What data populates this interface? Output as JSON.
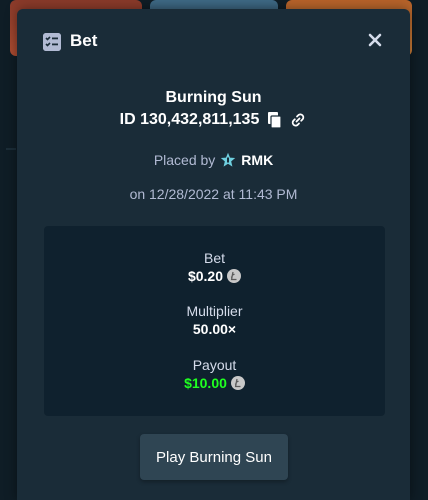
{
  "modal": {
    "title": "Bet",
    "game_name": "Burning Sun",
    "bet_id": "ID 130,432,811,135",
    "placed_by_prefix": "Placed by",
    "user": "RMK",
    "date_text": "on 12/28/2022 at 11:43 PM",
    "play_button_label": "Play Burning Sun"
  },
  "stats": {
    "bet_label": "Bet",
    "bet_value": "$0.20",
    "multiplier_label": "Multiplier",
    "multiplier_value": "50.00×",
    "payout_label": "Payout",
    "payout_value": "$10.00"
  },
  "icons": {
    "header": "bets-list-icon",
    "close": "close-icon",
    "copy": "copy-icon",
    "link": "link-icon",
    "user_rank": "star-rank-icon",
    "currency": "litecoin-icon"
  },
  "colors": {
    "modal_bg": "#1a2c38",
    "stats_bg": "#0f212e",
    "muted_text": "#b1bad3",
    "payout_green": "#1fff20",
    "button_bg": "#2f4553",
    "rank_star": "#6fd0e0"
  }
}
